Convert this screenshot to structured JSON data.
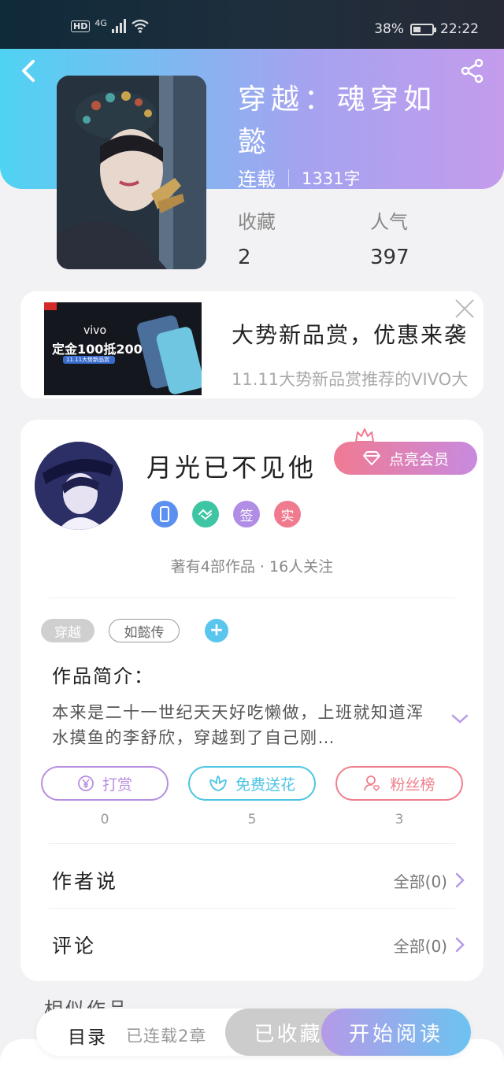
{
  "status_bar": {
    "network": "4G",
    "hd": "HD",
    "battery": "38%",
    "time": "22:22"
  },
  "book": {
    "title": "穿越：魂穿如懿",
    "status": "连载",
    "words": "1331字",
    "stats": {
      "favorites_label": "收藏",
      "favorites_value": "2",
      "popularity_label": "人气",
      "popularity_value": "397"
    }
  },
  "ad": {
    "title": "大势新品赏，优惠来袭",
    "desc": "11.11大势新品赏推荐的VIVO大",
    "image_brand": "vivo",
    "image_headline": "定金100抵200",
    "image_sub": "11.11大势新品赏"
  },
  "author": {
    "name": "月光已不见他",
    "vip_label": "点亮会员",
    "badges": [
      {
        "icon": "phone-badge",
        "text": "",
        "color": "#5b8ff0"
      },
      {
        "icon": "handshake-badge",
        "text": "",
        "color": "#3ec6a4"
      },
      {
        "icon": "sign-badge",
        "text": "签",
        "color": "#b18de6"
      },
      {
        "icon": "verified-badge",
        "text": "实",
        "color": "#f07a8e"
      }
    ],
    "stats": "著有4部作品 · 16人关注"
  },
  "tags": [
    {
      "label": "穿越",
      "style": "filled"
    },
    {
      "label": "如懿传",
      "style": "outline"
    }
  ],
  "intro": {
    "label": "作品简介：",
    "text": "本来是二十一世纪天天好吃懒做，上班就知道浑水摸鱼的李舒欣，穿越到了自己刚…"
  },
  "actions": [
    {
      "label": "打赏",
      "count": "0",
      "color": "#b78ee0",
      "icon": "yen-icon"
    },
    {
      "label": "免费送花",
      "count": "5",
      "color": "#4cc4e4",
      "icon": "flower-icon"
    },
    {
      "label": "粉丝榜",
      "count": "3",
      "color": "#ef7f8c",
      "icon": "fans-icon"
    }
  ],
  "rows": [
    {
      "title": "作者说",
      "right": "全部(0)"
    },
    {
      "title": "评论",
      "right": "全部(0)"
    }
  ],
  "similar_label": "相似作品",
  "bottom_bar": {
    "toc": "目录",
    "toc_sub": "已连载2章",
    "collected": "已收藏",
    "read": "开始阅读"
  },
  "colors": {
    "accent_purple": "#b59ae8",
    "accent_blue": "#4fd3f2",
    "accent_pink": "#f07a92"
  }
}
